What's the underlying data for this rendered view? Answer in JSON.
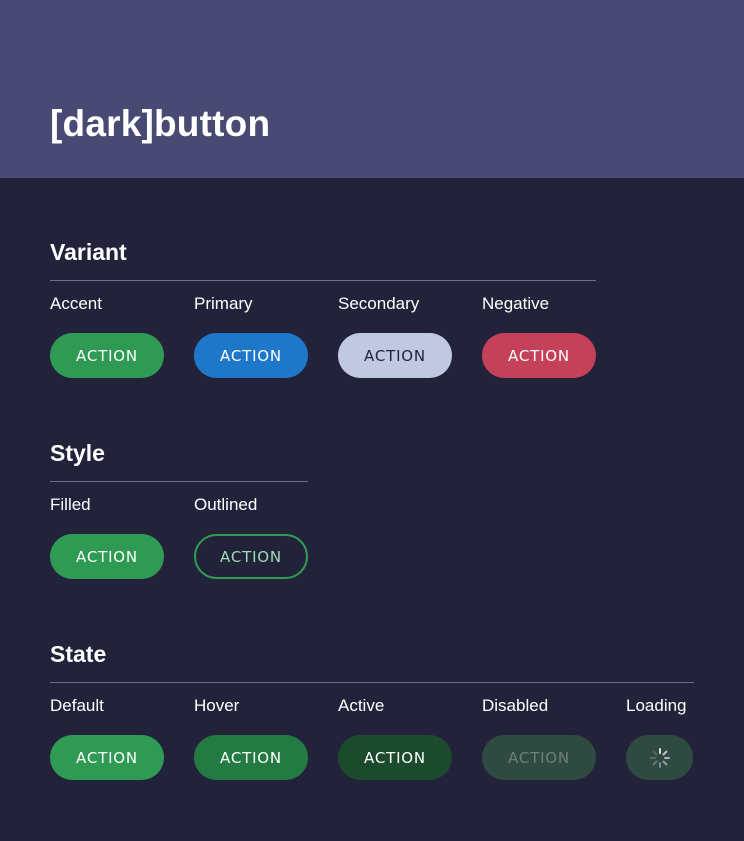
{
  "page": {
    "title": "[dark]button"
  },
  "sections": {
    "variant": {
      "title": "Variant",
      "items": [
        {
          "label": "Accent",
          "button": "ACTION"
        },
        {
          "label": "Primary",
          "button": "ACTION"
        },
        {
          "label": "Secondary",
          "button": "ACTION"
        },
        {
          "label": "Negative",
          "button": "ACTION"
        }
      ]
    },
    "style": {
      "title": "Style",
      "items": [
        {
          "label": "Filled",
          "button": "ACTION"
        },
        {
          "label": "Outlined",
          "button": "ACTION"
        }
      ]
    },
    "state": {
      "title": "State",
      "items": [
        {
          "label": "Default",
          "button": "ACTION"
        },
        {
          "label": "Hover",
          "button": "ACTION"
        },
        {
          "label": "Active",
          "button": "ACTION"
        },
        {
          "label": "Disabled",
          "button": "ACTION"
        },
        {
          "label": "Loading",
          "icon": "spinner-icon"
        }
      ]
    }
  },
  "colors": {
    "background": "#22233a",
    "header": "#484a74",
    "accent": "#2f9a53",
    "primary": "#1f77c9",
    "secondary": "#c1c9e2",
    "negative": "#c5415a"
  }
}
